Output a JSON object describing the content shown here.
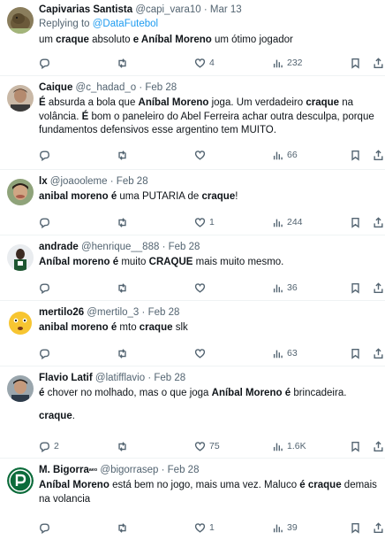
{
  "tweets": [
    {
      "name": "Capivarias Santista",
      "handle": "@capi_vara10",
      "sep": "·",
      "date": "Mar 13",
      "reply_prefix": "Replying to ",
      "reply_mention": "@DataFutebol",
      "segments": [
        {
          "t": "um ",
          "b": false
        },
        {
          "t": "craque",
          "b": true
        },
        {
          "t": " absoluto ",
          "b": false
        },
        {
          "t": "e Aníbal Moreno",
          "b": true
        },
        {
          "t": " um ótimo jogador",
          "b": false
        }
      ],
      "replies": "",
      "retweets": "",
      "likes": "4",
      "views": "232"
    },
    {
      "name": "Caique",
      "handle": "@c_hadad_o",
      "sep": "·",
      "date": "Feb 28",
      "segments": [
        {
          "t": "É",
          "b": true
        },
        {
          "t": " absurda a bola que ",
          "b": false
        },
        {
          "t": "Aníbal Moreno",
          "b": true
        },
        {
          "t": " joga. Um verdadeiro ",
          "b": false
        },
        {
          "t": "craque",
          "b": true
        },
        {
          "t": " na volância. ",
          "b": false
        },
        {
          "t": "É",
          "b": true
        },
        {
          "t": " bom o paneleiro do Abel Ferreira achar outra desculpa, porque fundamentos defensivos esse argentino tem MUITO.",
          "b": false
        }
      ],
      "replies": "",
      "retweets": "",
      "likes": "",
      "views": "66"
    },
    {
      "name": "lx",
      "handle": "@joaooleme",
      "sep": "·",
      "date": "Feb 28",
      "segments": [
        {
          "t": "anibal moreno",
          "b": true
        },
        {
          "t": " ",
          "b": false
        },
        {
          "t": "é",
          "b": true
        },
        {
          "t": " uma PUTARIA de ",
          "b": false
        },
        {
          "t": "craque",
          "b": true
        },
        {
          "t": "!",
          "b": false
        }
      ],
      "replies": "",
      "retweets": "",
      "likes": "1",
      "views": "244"
    },
    {
      "name": "andrade",
      "handle": "@henrique__888",
      "sep": "·",
      "date": "Feb 28",
      "segments": [
        {
          "t": "Aníbal moreno",
          "b": true
        },
        {
          "t": " ",
          "b": false
        },
        {
          "t": "é",
          "b": true
        },
        {
          "t": " muito ",
          "b": false
        },
        {
          "t": "CRAQUE",
          "b": true
        },
        {
          "t": " mais muito mesmo.",
          "b": false
        }
      ],
      "replies": "",
      "retweets": "",
      "likes": "",
      "views": "36"
    },
    {
      "name": "mertilo26",
      "handle": "@mertilo_3",
      "sep": "·",
      "date": "Feb 28",
      "segments": [
        {
          "t": "anibal moreno",
          "b": true
        },
        {
          "t": " ",
          "b": false
        },
        {
          "t": "é",
          "b": true
        },
        {
          "t": " mto ",
          "b": false
        },
        {
          "t": "craque",
          "b": true
        },
        {
          "t": " slk",
          "b": false
        }
      ],
      "replies": "",
      "retweets": "",
      "likes": "",
      "views": "63"
    },
    {
      "name": "Flavio Latif",
      "handle": "@latifflavio",
      "sep": "·",
      "date": "Feb 28",
      "segments": [
        {
          "t": "é",
          "b": true
        },
        {
          "t": " chover no molhado, mas o que joga ",
          "b": false
        },
        {
          "t": "Aníbal Moreno",
          "b": true
        },
        {
          "t": " ",
          "b": false
        },
        {
          "t": "é",
          "b": true
        },
        {
          "t": " brincadeira.",
          "b": false
        },
        {
          "br": true
        },
        {
          "t": "craque",
          "b": true
        },
        {
          "t": ".",
          "b": false
        }
      ],
      "replies": "2",
      "retweets": "",
      "likes": "75",
      "views": "1.6K"
    },
    {
      "name": "M. Bigorra",
      "name_suffix": "ᵃᵉᵒ",
      "handle": "@bigorrasep",
      "sep": "·",
      "date": "Feb 28",
      "segments": [
        {
          "t": "Aníbal Moreno",
          "b": true
        },
        {
          "t": " está bem no jogo, mais uma vez. Maluco ",
          "b": false
        },
        {
          "t": "é",
          "b": true
        },
        {
          "t": " ",
          "b": false
        },
        {
          "t": "craque",
          "b": true
        },
        {
          "t": " demais na volancia",
          "b": false
        }
      ],
      "replies": "",
      "retweets": "",
      "likes": "1",
      "views": "39"
    }
  ],
  "icons": {
    "reply": "reply-icon",
    "retweet": "retweet-icon",
    "like": "like-icon",
    "views": "views-icon",
    "bookmark": "bookmark-icon",
    "share": "share-icon"
  }
}
